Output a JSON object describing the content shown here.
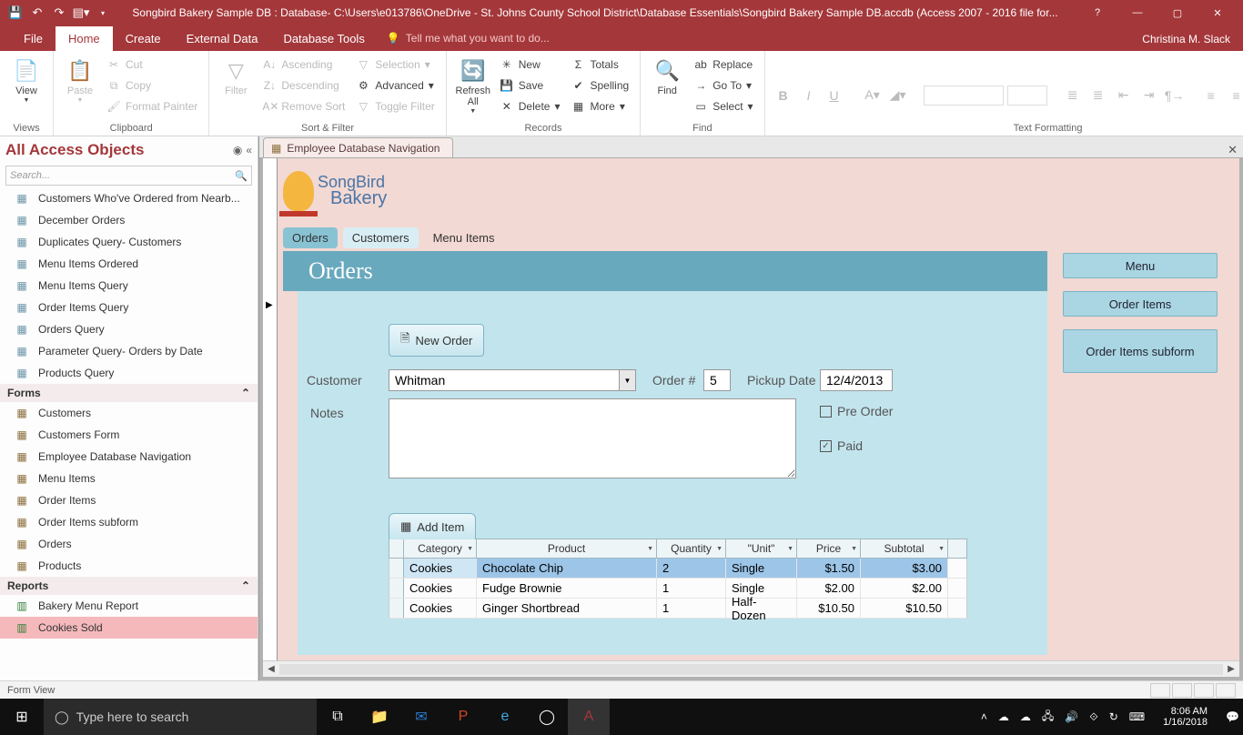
{
  "titlebar": {
    "title": "Songbird Bakery Sample DB : Database- C:\\Users\\e013786\\OneDrive - St. Johns County School District\\Database Essentials\\Songbird Bakery Sample DB.accdb (Access 2007 - 2016 file for...",
    "user": "Christina M. Slack"
  },
  "tabs": {
    "file": "File",
    "home": "Home",
    "create": "Create",
    "external": "External Data",
    "dbtools": "Database Tools",
    "tell": "Tell me what you want to do..."
  },
  "ribbon": {
    "views": {
      "label": "Views",
      "view": "View"
    },
    "clipboard": {
      "label": "Clipboard",
      "paste": "Paste",
      "cut": "Cut",
      "copy": "Copy",
      "fp": "Format Painter"
    },
    "sortfilter": {
      "label": "Sort & Filter",
      "filter": "Filter",
      "asc": "Ascending",
      "desc": "Descending",
      "remove": "Remove Sort",
      "selection": "Selection",
      "advanced": "Advanced",
      "toggle": "Toggle Filter"
    },
    "records": {
      "label": "Records",
      "refresh": "Refresh All",
      "new": "New",
      "save": "Save",
      "delete": "Delete",
      "totals": "Totals",
      "spelling": "Spelling",
      "more": "More"
    },
    "find": {
      "label": "Find",
      "find": "Find",
      "replace": "Replace",
      "goto": "Go To",
      "select": "Select"
    },
    "textfmt": {
      "label": "Text Formatting"
    }
  },
  "nav": {
    "header": "All Access Objects",
    "search_placeholder": "Search...",
    "queries": [
      "Customers Who've Ordered from Nearb...",
      "December Orders",
      "Duplicates Query- Customers",
      "Menu Items Ordered",
      "Menu Items Query",
      "Order Items Query",
      "Orders Query",
      "Parameter Query- Orders by Date",
      "Products Query"
    ],
    "forms_hdr": "Forms",
    "forms": [
      "Customers",
      "Customers Form",
      "Employee Database Navigation",
      "Menu Items",
      "Order Items",
      "Order Items  subform",
      "Orders",
      "Products"
    ],
    "reports_hdr": "Reports",
    "reports": [
      "Bakery Menu Report",
      "Cookies Sold"
    ]
  },
  "doc": {
    "tab": "Employee Database Navigation",
    "logo1": "SongBird",
    "logo2": "Bakery",
    "tabs": {
      "orders": "Orders",
      "customers": "Customers",
      "menu": "Menu Items"
    },
    "header": "Orders",
    "neworder": "New Order",
    "customer_lbl": "Customer",
    "customer_val": "Whitman",
    "orderno_lbl": "Order #",
    "orderno_val": "5",
    "pickup_lbl": "Pickup Date",
    "pickup_val": "12/4/2013",
    "notes_lbl": "Notes",
    "notes_val": "",
    "preorder_lbl": "Pre Order",
    "preorder_checked": false,
    "paid_lbl": "Paid",
    "paid_checked": true,
    "additem": "Add Item",
    "cols": {
      "cat": "Category",
      "prod": "Product",
      "qty": "Quantity",
      "unit": "\"Unit\"",
      "price": "Price",
      "sub": "Subtotal"
    },
    "rows": [
      {
        "cat": "Cookies",
        "prod": "Chocolate Chip",
        "qty": "2",
        "unit": "Single",
        "price": "$1.50",
        "sub": "$3.00",
        "sel": true
      },
      {
        "cat": "Cookies",
        "prod": "Fudge Brownie",
        "qty": "1",
        "unit": "Single",
        "price": "$2.00",
        "sub": "$2.00",
        "sel": false
      },
      {
        "cat": "Cookies",
        "prod": "Ginger Shortbread",
        "qty": "1",
        "unit": "Half-Dozen",
        "price": "$10.50",
        "sub": "$10.50",
        "sel": false
      }
    ],
    "sidebtns": [
      "Menu",
      "Order Items",
      "Order Items subform"
    ]
  },
  "status": {
    "text": "Form View"
  },
  "taskbar": {
    "search": "Type here to search",
    "time": "8:06 AM",
    "date": "1/16/2018"
  }
}
